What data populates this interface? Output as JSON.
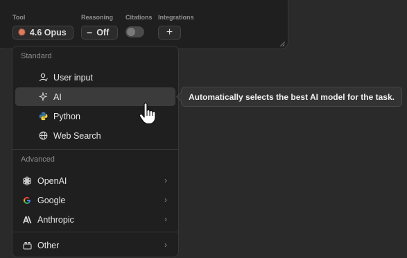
{
  "toolbar": {
    "tool_label": "Tool",
    "reasoning_label": "Reasoning",
    "citations_label": "Citations",
    "integrations_label": "Integrations",
    "tool_value": "4.6 Opus",
    "reasoning_value": "Off",
    "add_symbol": "+"
  },
  "menu": {
    "standard_header": "Standard",
    "advanced_header": "Advanced",
    "standard_items": [
      {
        "label": "User input",
        "icon": "user-icon"
      },
      {
        "label": "AI",
        "icon": "sparkle-icon"
      },
      {
        "label": "Python",
        "icon": "python-icon"
      },
      {
        "label": "Web Search",
        "icon": "globe-icon"
      }
    ],
    "advanced_items": [
      {
        "label": "OpenAI",
        "icon": "openai-icon"
      },
      {
        "label": "Google",
        "icon": "google-icon"
      },
      {
        "label": "Anthropic",
        "icon": "anthropic-icon"
      }
    ],
    "other_label": "Other"
  },
  "tooltip": "Automatically selects the best AI model for the task.",
  "colors": {
    "accent_star": "#e07a5a",
    "python_blue": "#3776ab",
    "python_yellow": "#ffd43b"
  }
}
